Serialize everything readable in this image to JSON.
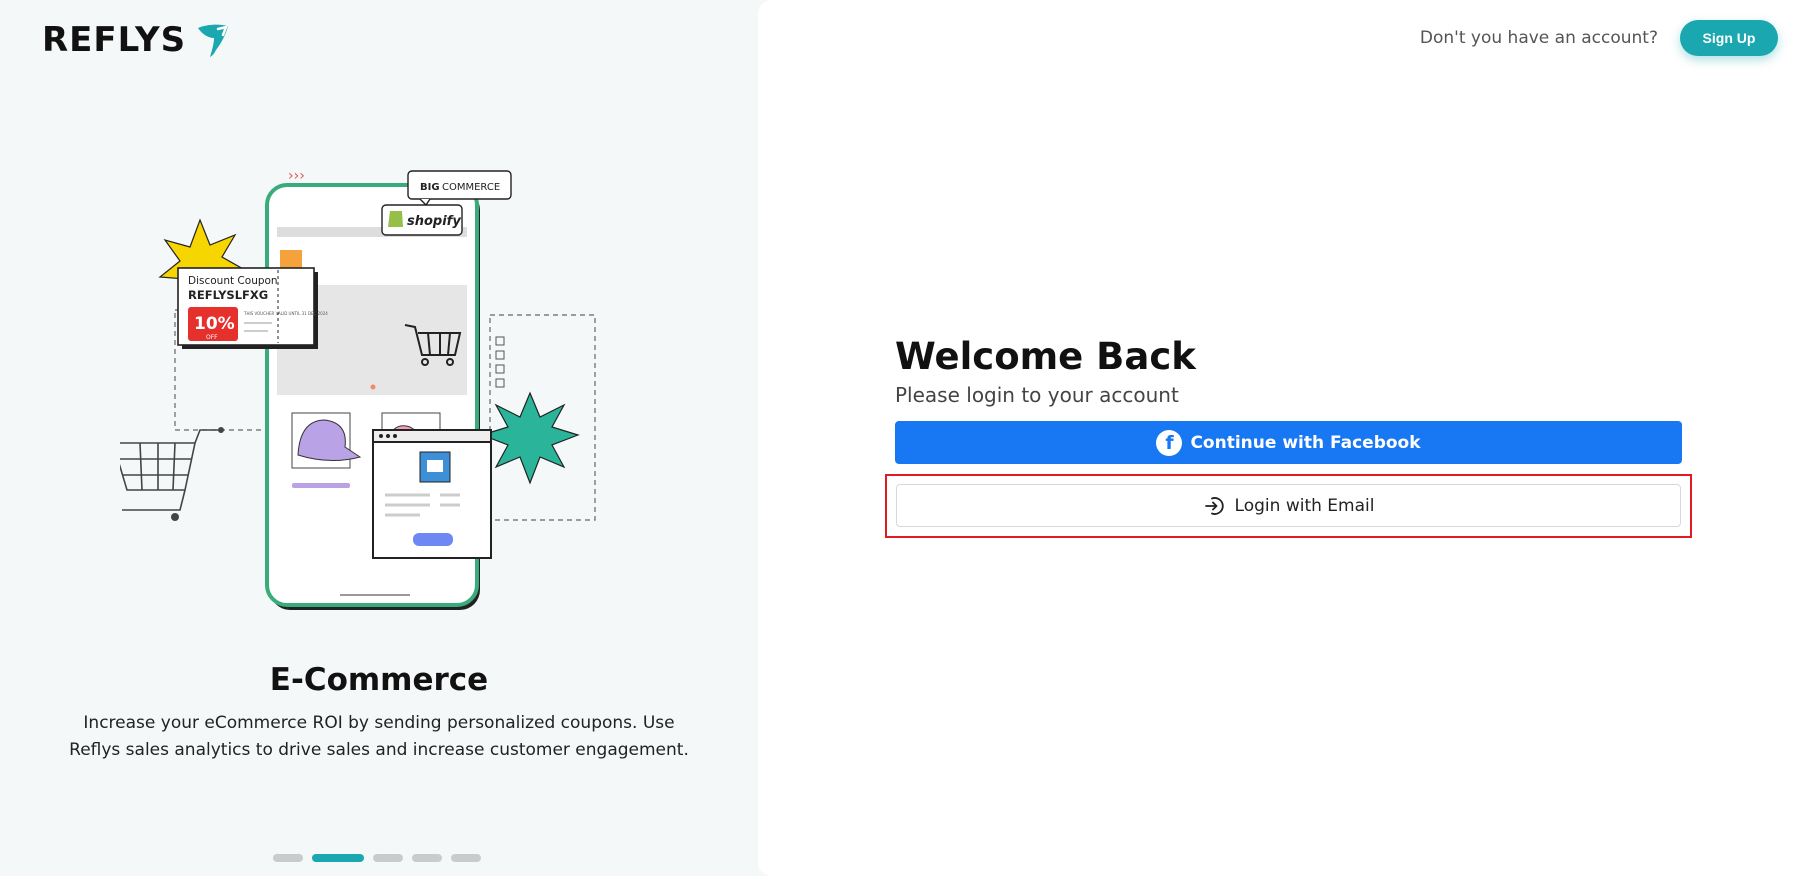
{
  "brand": {
    "name": "REFLYS",
    "accent": "#1aa7b0"
  },
  "illustration": {
    "coupon_title": "Discount Coupon",
    "coupon_code": "REFLYSLFXG",
    "coupon_percent": "10%",
    "coupon_off": "OFF",
    "coupon_note": "THIS VOUCHER VALID UNTIL 31 DEC 2024",
    "bigcommerce_big": "BIG",
    "bigcommerce_rest": "COMMERCE",
    "shopify": "shopify"
  },
  "slide": {
    "title": "E-Commerce",
    "description": "Increase your eCommerce ROI by sending personalized coupons. Use Reflys sales analytics to drive sales and increase customer engagement.",
    "active_index": 1,
    "count": 5
  },
  "header": {
    "no_account": "Don't you have an account?",
    "signup_label": "Sign Up"
  },
  "login": {
    "title": "Welcome Back",
    "subtitle": "Please login to your account",
    "facebook_label": "Continue with Facebook",
    "facebook_icon": "facebook-icon",
    "facebook_color": "#1877f2",
    "email_label": "Login with Email",
    "email_icon": "login-arrow-icon",
    "highlight_color": "#e01b22"
  }
}
